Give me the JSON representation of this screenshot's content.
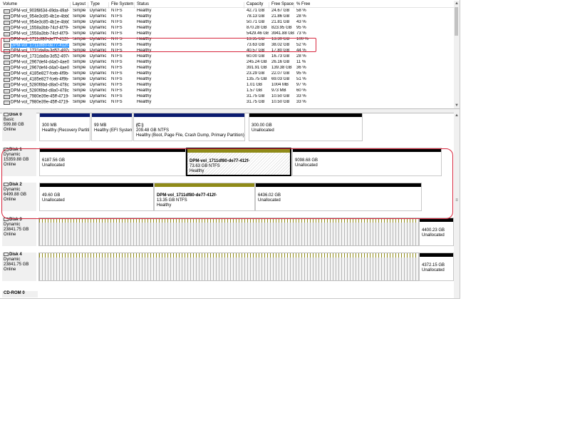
{
  "volume_table": {
    "headers": [
      "Volume",
      "Layout",
      "Type",
      "File System",
      "Status",
      "Capacity",
      "Free Space",
      "% Free"
    ],
    "rows": [
      {
        "volume": "DPM-vol_903f8634-49da-49af-",
        "layout": "Simple",
        "type": "Dynamic",
        "fs": "NTFS",
        "status": "Healthy",
        "capacity": "42.71 GB",
        "free": "24.67 GB",
        "pct": "58 %"
      },
      {
        "volume": "DPM-vol_954e3c85-4b1e-4bb0-",
        "layout": "Simple",
        "type": "Dynamic",
        "fs": "NTFS",
        "status": "Healthy",
        "capacity": "78.13 GB",
        "free": "21.86 GB",
        "pct": "28 %"
      },
      {
        "volume": "DPM-vol_954e3c85-4b1e-4bb0-",
        "layout": "Simple",
        "type": "Dynamic",
        "fs": "NTFS",
        "status": "Healthy",
        "capacity": "50.71 GB",
        "free": "21.81 GB",
        "pct": "43 %"
      },
      {
        "volume": "DPM-vol_1558a3bb-74cf-4f79-",
        "layout": "Simple",
        "type": "Dynamic",
        "fs": "NTFS",
        "status": "Healthy",
        "capacity": "870.28 GB",
        "free": "823.95 GB",
        "pct": "95 %"
      },
      {
        "volume": "DPM-vol_1558a3bb-74cf-4f79-",
        "layout": "Simple",
        "type": "Dynamic",
        "fs": "NTFS",
        "status": "Healthy",
        "capacity": "5429.46 GB",
        "free": "3941.88 GB",
        "pct": "73 %"
      },
      {
        "volume": "DPM-vol_1711df80-de77-412f-",
        "layout": "Simple",
        "type": "Dynamic",
        "fs": "NTFS",
        "status": "Healthy",
        "capacity": "13.35 GB",
        "free": "13.30 GB",
        "pct": "100 %"
      },
      {
        "volume": "DPM-vol_1711df80-de77-412f-",
        "layout": "Simple",
        "type": "Dynamic",
        "fs": "NTFS",
        "status": "Healthy",
        "capacity": "73.63 GB",
        "free": "38.02 GB",
        "pct": "52 %"
      },
      {
        "volume": "DPM-vol_1731da8a-3d52-4974-",
        "layout": "Simple",
        "type": "Dynamic",
        "fs": "NTFS",
        "status": "Healthy",
        "capacity": "40.57 GB",
        "free": "17.80 GB",
        "pct": "44 %"
      },
      {
        "volume": "DPM-vol_1731da8a-3d52-4974-",
        "layout": "Simple",
        "type": "Dynamic",
        "fs": "NTFS",
        "status": "Healthy",
        "capacity": "60.00 GB",
        "free": "16.73 GB",
        "pct": "28 %"
      },
      {
        "volume": "DPM-vol_2967def4-d4a0-4ae0-",
        "layout": "Simple",
        "type": "Dynamic",
        "fs": "NTFS",
        "status": "Healthy",
        "capacity": "245.24 GB",
        "free": "26.16 GB",
        "pct": "11 %"
      },
      {
        "volume": "DPM-vol_2967def4-d4a0-4ae0-",
        "layout": "Simple",
        "type": "Dynamic",
        "fs": "NTFS",
        "status": "Healthy",
        "capacity": "391.91 GB",
        "free": "139.38 GB",
        "pct": "36 %"
      },
      {
        "volume": "DPM-vol_4185e827-fceb-4f9b-",
        "layout": "Simple",
        "type": "Dynamic",
        "fs": "NTFS",
        "status": "Healthy",
        "capacity": "23.29 GB",
        "free": "22.07 GB",
        "pct": "95 %"
      },
      {
        "volume": "DPM-vol_4185e827-fceb-4f9b-",
        "layout": "Simple",
        "type": "Dynamic",
        "fs": "NTFS",
        "status": "Healthy",
        "capacity": "135.75 GB",
        "free": "69.03 GB",
        "pct": "51 %"
      },
      {
        "volume": "DPM-vol_5280f8bd-d8a0-478c-",
        "layout": "Simple",
        "type": "Dynamic",
        "fs": "NTFS",
        "status": "Healthy",
        "capacity": "1.01 GB",
        "free": "1004 MB",
        "pct": "97 %"
      },
      {
        "volume": "DPM-vol_5280f8bd-d8a0-478c-",
        "layout": "Simple",
        "type": "Dynamic",
        "fs": "NTFS",
        "status": "Healthy",
        "capacity": "1.57 GB",
        "free": "973 MB",
        "pct": "60 %"
      },
      {
        "volume": "DPM-vol_7980e39e-45ff-4719-",
        "layout": "Simple",
        "type": "Dynamic",
        "fs": "NTFS",
        "status": "Healthy",
        "capacity": "31.75 GB",
        "free": "10.50 GB",
        "pct": "33 %"
      },
      {
        "volume": "DPM-vol_7980e39e-45ff-4719-",
        "layout": "Simple",
        "type": "Dynamic",
        "fs": "NTFS",
        "status": "Healthy",
        "capacity": "31.75 GB",
        "free": "10.50 GB",
        "pct": "33 %"
      }
    ],
    "selected_row": 6
  },
  "disks": [
    {
      "name": "Disk 0",
      "lines": [
        "Basic",
        "599.88 GB",
        "Online"
      ],
      "partitions": [
        {
          "bar": "blue",
          "lines": [
            "300 MB",
            "Healthy (Recovery Partiti"
          ]
        },
        {
          "bar": "blue",
          "lines": [
            "99 MB",
            "Healthy (EFI System"
          ]
        },
        {
          "bar": "blue",
          "lines": [
            "(C:)",
            "209.48 GB NTFS",
            "Healthy (Boot, Page File, Crash Dump, Primary Partition)"
          ]
        },
        {
          "bar": "black",
          "lines": [
            "300.00 GB",
            "Unallocated"
          ]
        }
      ]
    },
    {
      "name": "Disk 1",
      "lines": [
        "Dynamic",
        "15359.88 GB",
        "Online"
      ],
      "partitions": [
        {
          "bar": "black",
          "lines": [
            "6187.56 GB",
            "Unallocated"
          ]
        },
        {
          "bar": "olive",
          "lines": [
            "DPM-vol_1711df80-de77-412f-",
            "73.63 GB NTFS",
            "Healthy"
          ],
          "selected": true
        },
        {
          "bar": "black",
          "lines": [
            "9098.68 GB",
            "Unallocated"
          ]
        }
      ]
    },
    {
      "name": "Disk 2",
      "lines": [
        "Dynamic",
        "6499.88 GB",
        "Online"
      ],
      "partitions": [
        {
          "bar": "black",
          "lines": [
            "49.60 GB",
            "Unallocated"
          ]
        },
        {
          "bar": "olive",
          "lines": [
            "DPM-vol_1711df80-de77-412f-",
            "13.35 GB NTFS",
            "Healthy"
          ]
        },
        {
          "bar": "black",
          "lines": [
            "6436.02 GB",
            "Unallocated"
          ]
        }
      ]
    },
    {
      "name": "Disk 3",
      "lines": [
        "Dynamic",
        "23841.75 GB",
        "Online"
      ],
      "partitions": [
        {
          "bar": "black",
          "lines": [
            "4400.23 GB",
            "Unallocated"
          ]
        }
      ]
    },
    {
      "name": "Disk 4",
      "lines": [
        "Dynamic",
        "23841.75 GB",
        "Online"
      ],
      "partitions": [
        {
          "bar": "black",
          "lines": [
            "4372.15 GB",
            "Unallocated"
          ]
        }
      ]
    }
  ],
  "cdrom": {
    "name": "CD-ROM 0"
  },
  "icons": {
    "disk": "disk-icon",
    "volume": "volume-icon",
    "scroll_up": "scroll-up-arrow-icon",
    "scroll_down": "scroll-down-arrow-icon"
  },
  "colors": {
    "primary_partition_bar": "#0b1b6f",
    "unallocated_bar": "#000000",
    "simple_volume_bar": "#8f8a18",
    "selection": "#3399ff",
    "annotation": "#d7263d"
  }
}
